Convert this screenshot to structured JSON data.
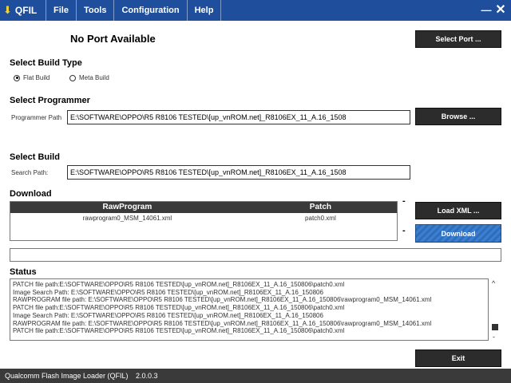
{
  "app": {
    "logo_text": "QFIL"
  },
  "menu": [
    "File",
    "Tools",
    "Configuration",
    "Help"
  ],
  "window": {
    "minimize_glyph": "—",
    "close_glyph": "✕"
  },
  "port": {
    "status": "No Port Available",
    "select_port_label": "Select Port ..."
  },
  "build_type": {
    "heading": "Select Build Type",
    "options": [
      {
        "label": "Flat Build",
        "selected": true
      },
      {
        "label": "Meta Build",
        "selected": false
      }
    ]
  },
  "programmer": {
    "heading": "Select Programmer",
    "field_label": "Programmer Path",
    "value": "E:\\SOFTWARE\\OPPO\\R5 R8106 TESTED\\[up_vnROM.net]_R8106EX_11_A.16_1508",
    "browse_label": "Browse ..."
  },
  "build": {
    "heading": "Select Build",
    "field_label": "Search Path:",
    "value": "E:\\SOFTWARE\\OPPO\\R5 R8106 TESTED\\[up_vnROM.net]_R8106EX_11_A.16_1508"
  },
  "download": {
    "heading": "Download",
    "columns": [
      "RawProgram",
      "Patch"
    ],
    "rows": [
      [
        "rawprogram0_MSM_14061.xml",
        "patch0.xml"
      ]
    ],
    "dash": "-",
    "load_xml_label": "Load XML ...",
    "download_label": "Download"
  },
  "status": {
    "heading": "Status",
    "lines": [
      "PATCH file path:E:\\SOFTWARE\\OPPO\\R5 R8106 TESTED\\[up_vnROM.net]_R8106EX_11_A.16_150806\\patch0.xml",
      "Image Search Path: E:\\SOFTWARE\\OPPO\\R5 R8106 TESTED\\[up_vnROM.net]_R8106EX_11_A.16_150806",
      "RAWPROGRAM file path: E:\\SOFTWARE\\OPPO\\R5 R8106 TESTED\\[up_vnROM.net]_R8106EX_11_A.16_150806\\rawprogram0_MSM_14061.xml",
      "PATCH file path:E:\\SOFTWARE\\OPPO\\R5 R8106 TESTED\\[up_vnROM.net]_R8106EX_11_A.16_150806\\patch0.xml",
      "Image Search Path: E:\\SOFTWARE\\OPPO\\R5 R8106 TESTED\\[up_vnROM.net]_R8106EX_11_A.16_150806",
      "RAWPROGRAM file path: E:\\SOFTWARE\\OPPO\\R5 R8106 TESTED\\[up_vnROM.net]_R8106EX_11_A.16_150806\\rawprogram0_MSM_14061.xml",
      "PATCH file path:E:\\SOFTWARE\\OPPO\\R5 R8106 TESTED\\[up_vnROM.net]_R8106EX_11_A.16_150806\\patch0.xml"
    ],
    "scroll_up": "^",
    "scroll_down": "-"
  },
  "exit_label": "Exit",
  "footer": {
    "app_name": "Qualcomm Flash Image Loader (QFIL)",
    "version": "2.0.0.3"
  }
}
